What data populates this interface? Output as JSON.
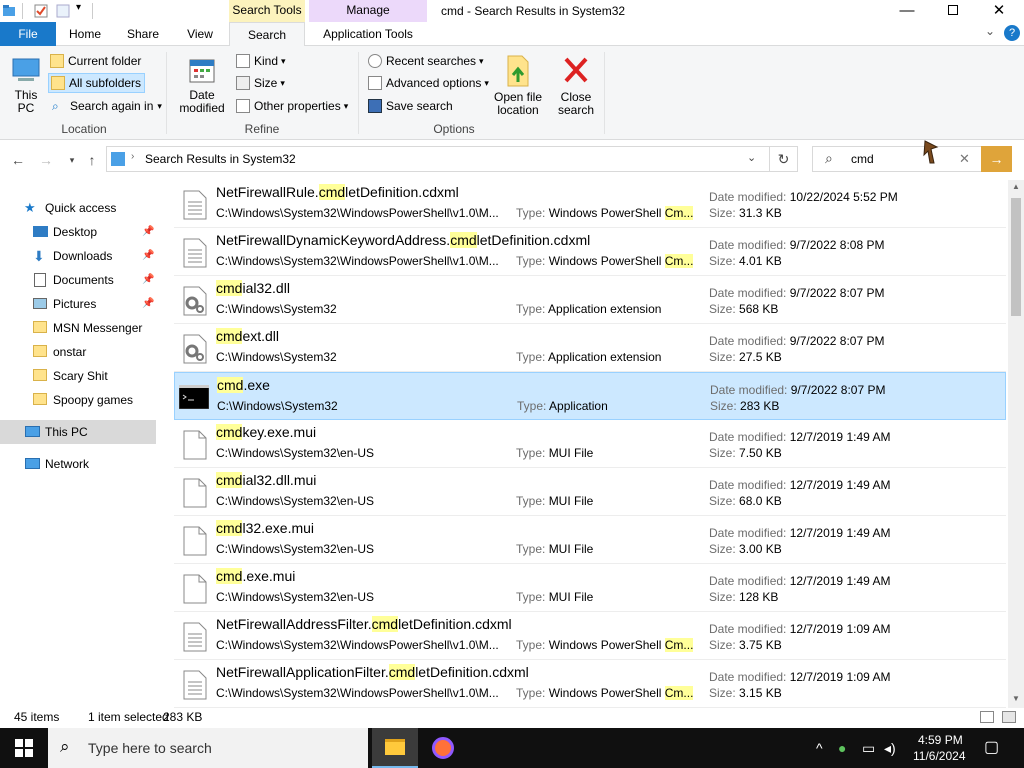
{
  "window": {
    "title": "cmd - Search Results in System32",
    "context_tabs": {
      "search_tools": "Search Tools",
      "manage": "Manage"
    }
  },
  "ribbon": {
    "tabs": {
      "file": "File",
      "home": "Home",
      "share": "Share",
      "view": "View",
      "search": "Search",
      "app_tools": "Application Tools"
    },
    "location": {
      "this_pc": "This PC",
      "current_folder": "Current folder",
      "all_subfolders": "All subfolders",
      "search_again": "Search again in",
      "group": "Location"
    },
    "refine": {
      "date_modified": "Date modified",
      "kind": "Kind",
      "size": "Size",
      "other_properties": "Other properties",
      "group": "Refine"
    },
    "options": {
      "recent_searches": "Recent searches",
      "advanced_options": "Advanced options",
      "save_search": "Save search",
      "open_file_location": "Open file location",
      "close_search": "Close search",
      "group": "Options"
    }
  },
  "address": {
    "path": "Search Results in System32"
  },
  "search": {
    "query": "cmd"
  },
  "nav": {
    "quick_access": "Quick access",
    "items": [
      "Desktop",
      "Downloads",
      "Documents",
      "Pictures",
      "MSN Messenger",
      "onstar",
      "Scary Shit",
      "Spoopy games"
    ],
    "this_pc": "This PC",
    "network": "Network"
  },
  "labels": {
    "type": "Type:",
    "date_modified": "Date modified:",
    "size": "Size:"
  },
  "results": [
    {
      "pre": "NetFirewallRule.",
      "hl": "cmd",
      "post": "letDefinition.cdxml",
      "path": "C:\\Windows\\System32\\WindowsPowerShell\\v1.0\\M...",
      "type_pre": "Windows PowerShell ",
      "type_hl": "Cm...",
      "type_post": "",
      "date": "10/22/2024 5:52 PM",
      "size": "31.3 KB",
      "icon": "document-icon"
    },
    {
      "pre": "NetFirewallDynamicKeywordAddress.",
      "hl": "cmd",
      "post": "letDefinition.cdxml",
      "path": "C:\\Windows\\System32\\WindowsPowerShell\\v1.0\\M...",
      "type_pre": "Windows PowerShell ",
      "type_hl": "Cm...",
      "type_post": "",
      "date": "9/7/2022 8:08 PM",
      "size": "4.01 KB",
      "icon": "document-icon"
    },
    {
      "pre": "",
      "hl": "cmd",
      "post": "ial32.dll",
      "path": "C:\\Windows\\System32",
      "type_pre": "Application extension",
      "type_hl": "",
      "type_post": "",
      "date": "9/7/2022 8:07 PM",
      "size": "568 KB",
      "icon": "dll-gear-icon"
    },
    {
      "pre": "",
      "hl": "cmd",
      "post": "ext.dll",
      "path": "C:\\Windows\\System32",
      "type_pre": "Application extension",
      "type_hl": "",
      "type_post": "",
      "date": "9/7/2022 8:07 PM",
      "size": "27.5 KB",
      "icon": "dll-gear-icon"
    },
    {
      "pre": "",
      "hl": "cmd",
      "post": ".exe",
      "path": "C:\\Windows\\System32",
      "type_pre": "Application",
      "type_hl": "",
      "type_post": "",
      "date": "9/7/2022 8:07 PM",
      "size": "283 KB",
      "icon": "console-app-icon",
      "selected": true
    },
    {
      "pre": "",
      "hl": "cmd",
      "post": "key.exe.mui",
      "path": "C:\\Windows\\System32\\en-US",
      "type_pre": "MUI File",
      "type_hl": "",
      "type_post": "",
      "date": "12/7/2019 1:49 AM",
      "size": "7.50 KB",
      "icon": "blank-file-icon"
    },
    {
      "pre": "",
      "hl": "cmd",
      "post": "ial32.dll.mui",
      "path": "C:\\Windows\\System32\\en-US",
      "type_pre": "MUI File",
      "type_hl": "",
      "type_post": "",
      "date": "12/7/2019 1:49 AM",
      "size": "68.0 KB",
      "icon": "blank-file-icon"
    },
    {
      "pre": "",
      "hl": "cmd",
      "post": "l32.exe.mui",
      "path": "C:\\Windows\\System32\\en-US",
      "type_pre": "MUI File",
      "type_hl": "",
      "type_post": "",
      "date": "12/7/2019 1:49 AM",
      "size": "3.00 KB",
      "icon": "blank-file-icon"
    },
    {
      "pre": "",
      "hl": "cmd",
      "post": ".exe.mui",
      "path": "C:\\Windows\\System32\\en-US",
      "type_pre": "MUI File",
      "type_hl": "",
      "type_post": "",
      "date": "12/7/2019 1:49 AM",
      "size": "128 KB",
      "icon": "blank-file-icon"
    },
    {
      "pre": "NetFirewallAddressFilter.",
      "hl": "cmd",
      "post": "letDefinition.cdxml",
      "path": "C:\\Windows\\System32\\WindowsPowerShell\\v1.0\\M...",
      "type_pre": "Windows PowerShell ",
      "type_hl": "Cm...",
      "type_post": "",
      "date": "12/7/2019 1:09 AM",
      "size": "3.75 KB",
      "icon": "document-icon"
    },
    {
      "pre": "NetFirewallApplicationFilter.",
      "hl": "cmd",
      "post": "letDefinition.cdxml",
      "path": "C:\\Windows\\System32\\WindowsPowerShell\\v1.0\\M...",
      "type_pre": "Windows PowerShell ",
      "type_hl": "Cm...",
      "type_post": "",
      "date": "12/7/2019 1:09 AM",
      "size": "3.15 KB",
      "icon": "document-icon"
    }
  ],
  "status": {
    "count": "45 items",
    "selection": "1 item selected",
    "selection_size": "283 KB"
  },
  "taskbar": {
    "search_placeholder": "Type here to search",
    "time": "4:59 PM",
    "date": "11/6/2024"
  },
  "colors": {
    "accent": "#1979ca",
    "selection": "#cce8ff",
    "highlight": "#ffff99",
    "search_tools_tab": "#fcf3bd",
    "manage_tab": "#ecd9fa",
    "go_button": "#dfa43a"
  }
}
